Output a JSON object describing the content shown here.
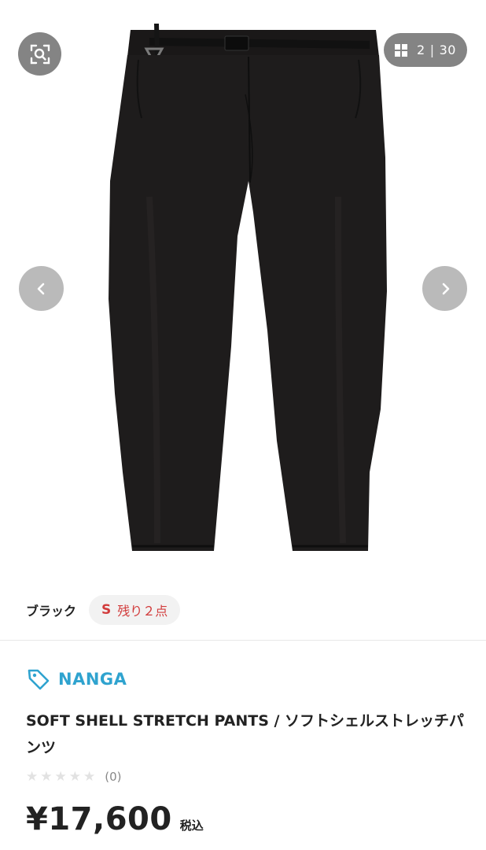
{
  "gallery": {
    "image_alt": "SOFT SHELL STRETCH PANTS / ソフトシェルストレッチパンツ",
    "zoom_icon": "zoom-search-icon",
    "counter": {
      "icon": "grid-icon",
      "current": "2",
      "separator": "|",
      "total": "30"
    },
    "prev_icon": "chevron-left-icon",
    "next_icon": "chevron-right-icon"
  },
  "variant": {
    "color": "ブラック",
    "size": "S",
    "stock": "残り２点"
  },
  "brand": {
    "icon": "tag-icon",
    "name": "NANGA",
    "color": "#2fa3cf"
  },
  "product": {
    "title": "SOFT SHELL STRETCH PANTS / ソフトシェルストレッチパンツ",
    "rating_count": "(0)",
    "rating_stars": 0,
    "price": "¥17,600",
    "tax_label": "税込"
  },
  "colors": {
    "stock_red": "#d23c3c",
    "pants": "#1c1a1a"
  }
}
